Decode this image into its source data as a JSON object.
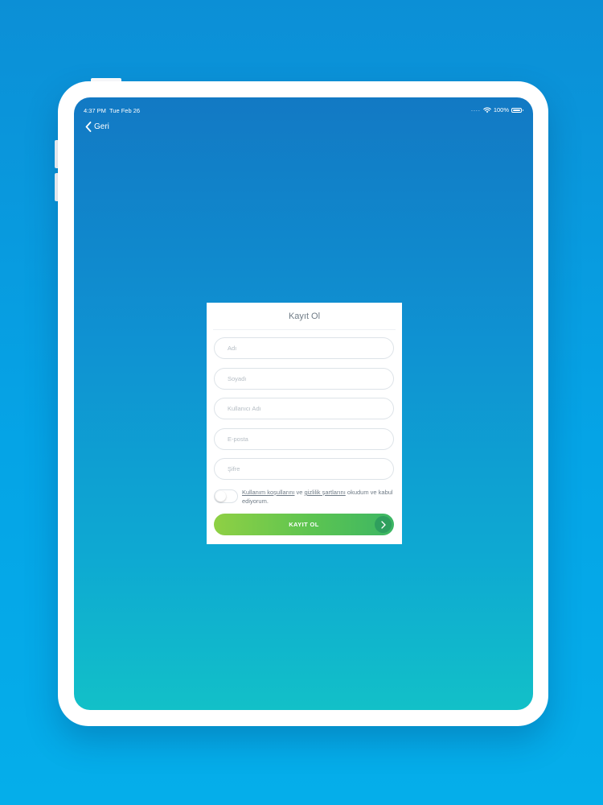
{
  "status_bar": {
    "time": "4:37 PM",
    "date": "Tue Feb 26",
    "signal_dots": "....",
    "battery": "100%",
    "icons": [
      "wifi-icon",
      "battery-icon"
    ]
  },
  "nav": {
    "back_label": "Geri",
    "back_icon": "chevron-left-icon"
  },
  "form": {
    "title": "Kayıt Ol",
    "fields": [
      {
        "placeholder": "Adı",
        "value": ""
      },
      {
        "placeholder": "Soyadı",
        "value": ""
      },
      {
        "placeholder": "Kullanıcı Adı",
        "value": ""
      },
      {
        "placeholder": "E-posta",
        "value": ""
      },
      {
        "placeholder": "Şifre",
        "value": ""
      }
    ],
    "agreement": {
      "toggle_on": false,
      "terms_link": "Kullanım koşullarını",
      "connector": " ve ",
      "privacy_link": "gizlilik şartlarını",
      "suffix": " okudum ve kabul ediyorum."
    },
    "submit_label": "KAYIT OL",
    "submit_icon": "chevron-right-icon"
  },
  "colors": {
    "page_background": "#05a4e6",
    "screen_gradient_top": "#1279c4",
    "screen_gradient_bottom": "#12c0c8",
    "button_gradient_start": "#8fd044",
    "button_gradient_end": "#3cb664",
    "text_muted": "#6f7b86"
  }
}
